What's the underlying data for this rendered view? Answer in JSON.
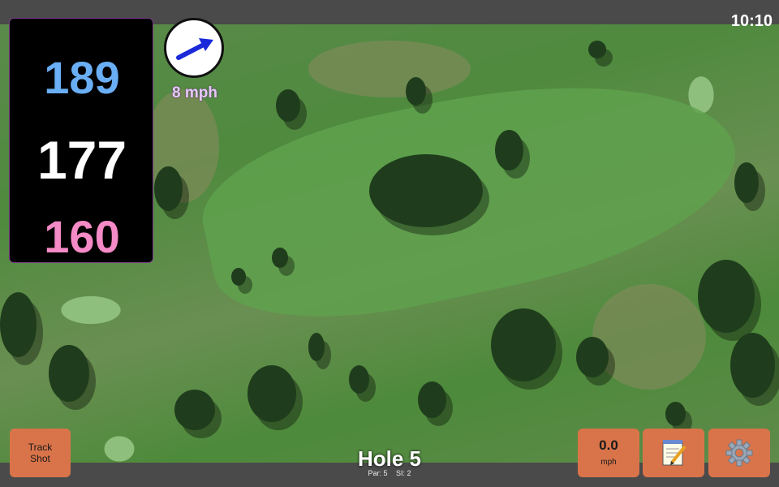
{
  "status_bar": {
    "time": "10:10"
  },
  "distances": {
    "back": "189",
    "middle": "177",
    "front": "160"
  },
  "wind": {
    "speed_label": "8 mph",
    "icon": "wind-arrow-icon"
  },
  "buttons": {
    "track_shot_line1": "Track",
    "track_shot_line2": "Shot",
    "speed_value": "0.0",
    "speed_unit": "mph",
    "notes_icon": "notepad-icon",
    "settings_icon": "gear-icon"
  },
  "hole": {
    "title": "Hole 5",
    "par": "Par: 5",
    "si": "SI: 2"
  },
  "colors": {
    "back": "#6aaef5",
    "middle": "#ffffff",
    "front": "#f48ac6",
    "button": "#d9744a"
  }
}
